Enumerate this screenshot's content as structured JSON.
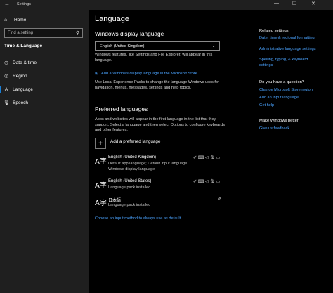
{
  "window": {
    "title": "Settings",
    "back_glyph": "←",
    "min_glyph": "—",
    "max_glyph": "☐",
    "close_glyph": "✕"
  },
  "sidebar": {
    "home_label": "Home",
    "home_icon": "⌂",
    "search_placeholder": "Find a setting",
    "search_icon": "⚲",
    "section_title": "Time & Language",
    "items": [
      {
        "label": "Date & time",
        "icon": "◷"
      },
      {
        "label": "Region",
        "icon": "◎"
      },
      {
        "label": "Language",
        "icon": "A",
        "selected": true
      },
      {
        "label": "Speech",
        "icon": "🎙"
      }
    ]
  },
  "main": {
    "title": "Language",
    "display_heading": "Windows display language",
    "display_value": "English (United Kingdom)",
    "display_desc": "Windows features, like Settings and File Explorer, will appear in this language.",
    "store_link": "Add a Windows display language in the Microsoft Store",
    "store_icon": "⊞",
    "lxp_desc": "Use Local Experience Packs to change the language Windows uses for navigation, menus, messages, settings and help topics.",
    "preferred_heading": "Preferred languages",
    "preferred_desc": "Apps and websites will appear in the first language in the list that they support. Select a language and then select Options to configure keyboards and other features.",
    "add_label": "Add a preferred language",
    "add_glyph": "+",
    "languages": [
      {
        "glyph": "A字",
        "name": "English (United Kingdom)",
        "sub1": "Default app language; Default input language",
        "sub2": "Windows display language",
        "features": "✐ ⌨ ◁ 🎙 ▭"
      },
      {
        "glyph": "A字",
        "name": "English (United States)",
        "sub1": "Language pack installed",
        "sub2": "",
        "features": "✐ ⌨ ◁ 🎙 ▭"
      },
      {
        "glyph": "A字",
        "name": "日本語",
        "sub1": "Language pack installed",
        "sub2": "",
        "features": "✐"
      }
    ],
    "input_method_link": "Choose an input method to always use as default"
  },
  "right": {
    "related_heading": "Related settings",
    "related_links": [
      "Date, time & regional formatting",
      "Administrative language settings",
      "Spelling, typing, & keyboard settings"
    ],
    "question_heading": "Do you have a question?",
    "question_links": [
      "Change Microsoft Store region",
      "Add an input language",
      "Get help"
    ],
    "better_heading": "Make Windows better",
    "better_links": [
      "Give us feedback"
    ]
  },
  "colors": {
    "accent": "#4aa3ff",
    "sidebar_bg": "#1f1f1f",
    "main_bg": "#000000"
  }
}
